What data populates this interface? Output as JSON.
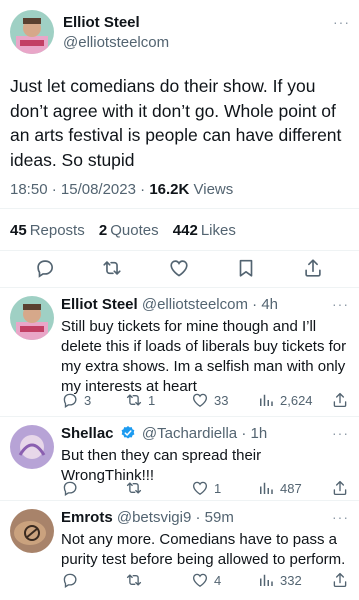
{
  "main_post": {
    "author_name": "Elliot Steel",
    "author_handle": "@elliotsteelcom",
    "more": "···",
    "text": "Just let comedians do their show. If you don’t agree with it don’t go. Whole point of an arts festival is people can have different ideas. So stupid",
    "time": "18:50",
    "date": "15/08/2023",
    "views_count": "16.2K",
    "views_label": "Views",
    "reposts_count": "45",
    "reposts_label": "Reposts",
    "quotes_count": "2",
    "quotes_label": "Quotes",
    "likes_count": "442",
    "likes_label": "Likes",
    "actions": [
      "reply-icon",
      "repost-icon",
      "like-icon",
      "bookmark-icon",
      "share-icon"
    ]
  },
  "replies": [
    {
      "name": "Elliot Steel",
      "handle": "@elliotsteelcom",
      "dot": "·",
      "time": "4h",
      "text": "Still buy tickets for mine though and I’ll delete this if loads of liberals buy tickets for my extra shows. Im a selfish man with only my interests at heart",
      "replies": "3",
      "reposts": "1",
      "likes": "33",
      "views": "2,624",
      "verified": false
    },
    {
      "name": "Shellac",
      "handle": "@Tachardiella",
      "dot": "·",
      "time": "1h",
      "text": "But then they can spread their WrongThink!!!",
      "replies": "",
      "reposts": "",
      "likes": "1",
      "views": "487",
      "verified": true
    },
    {
      "name": "Emrots",
      "handle": "@betsvigi9",
      "dot": "·",
      "time": "59m",
      "text": "Not any more.  Comedians have to pass a purity test before being allowed to perform.",
      "replies": "",
      "reposts": "",
      "likes": "4",
      "views": "332",
      "verified": false
    }
  ],
  "colors": {
    "text": "#0f1419",
    "secondary": "#536471",
    "divider": "#eff3f4",
    "verified": "#1d9bf0"
  }
}
